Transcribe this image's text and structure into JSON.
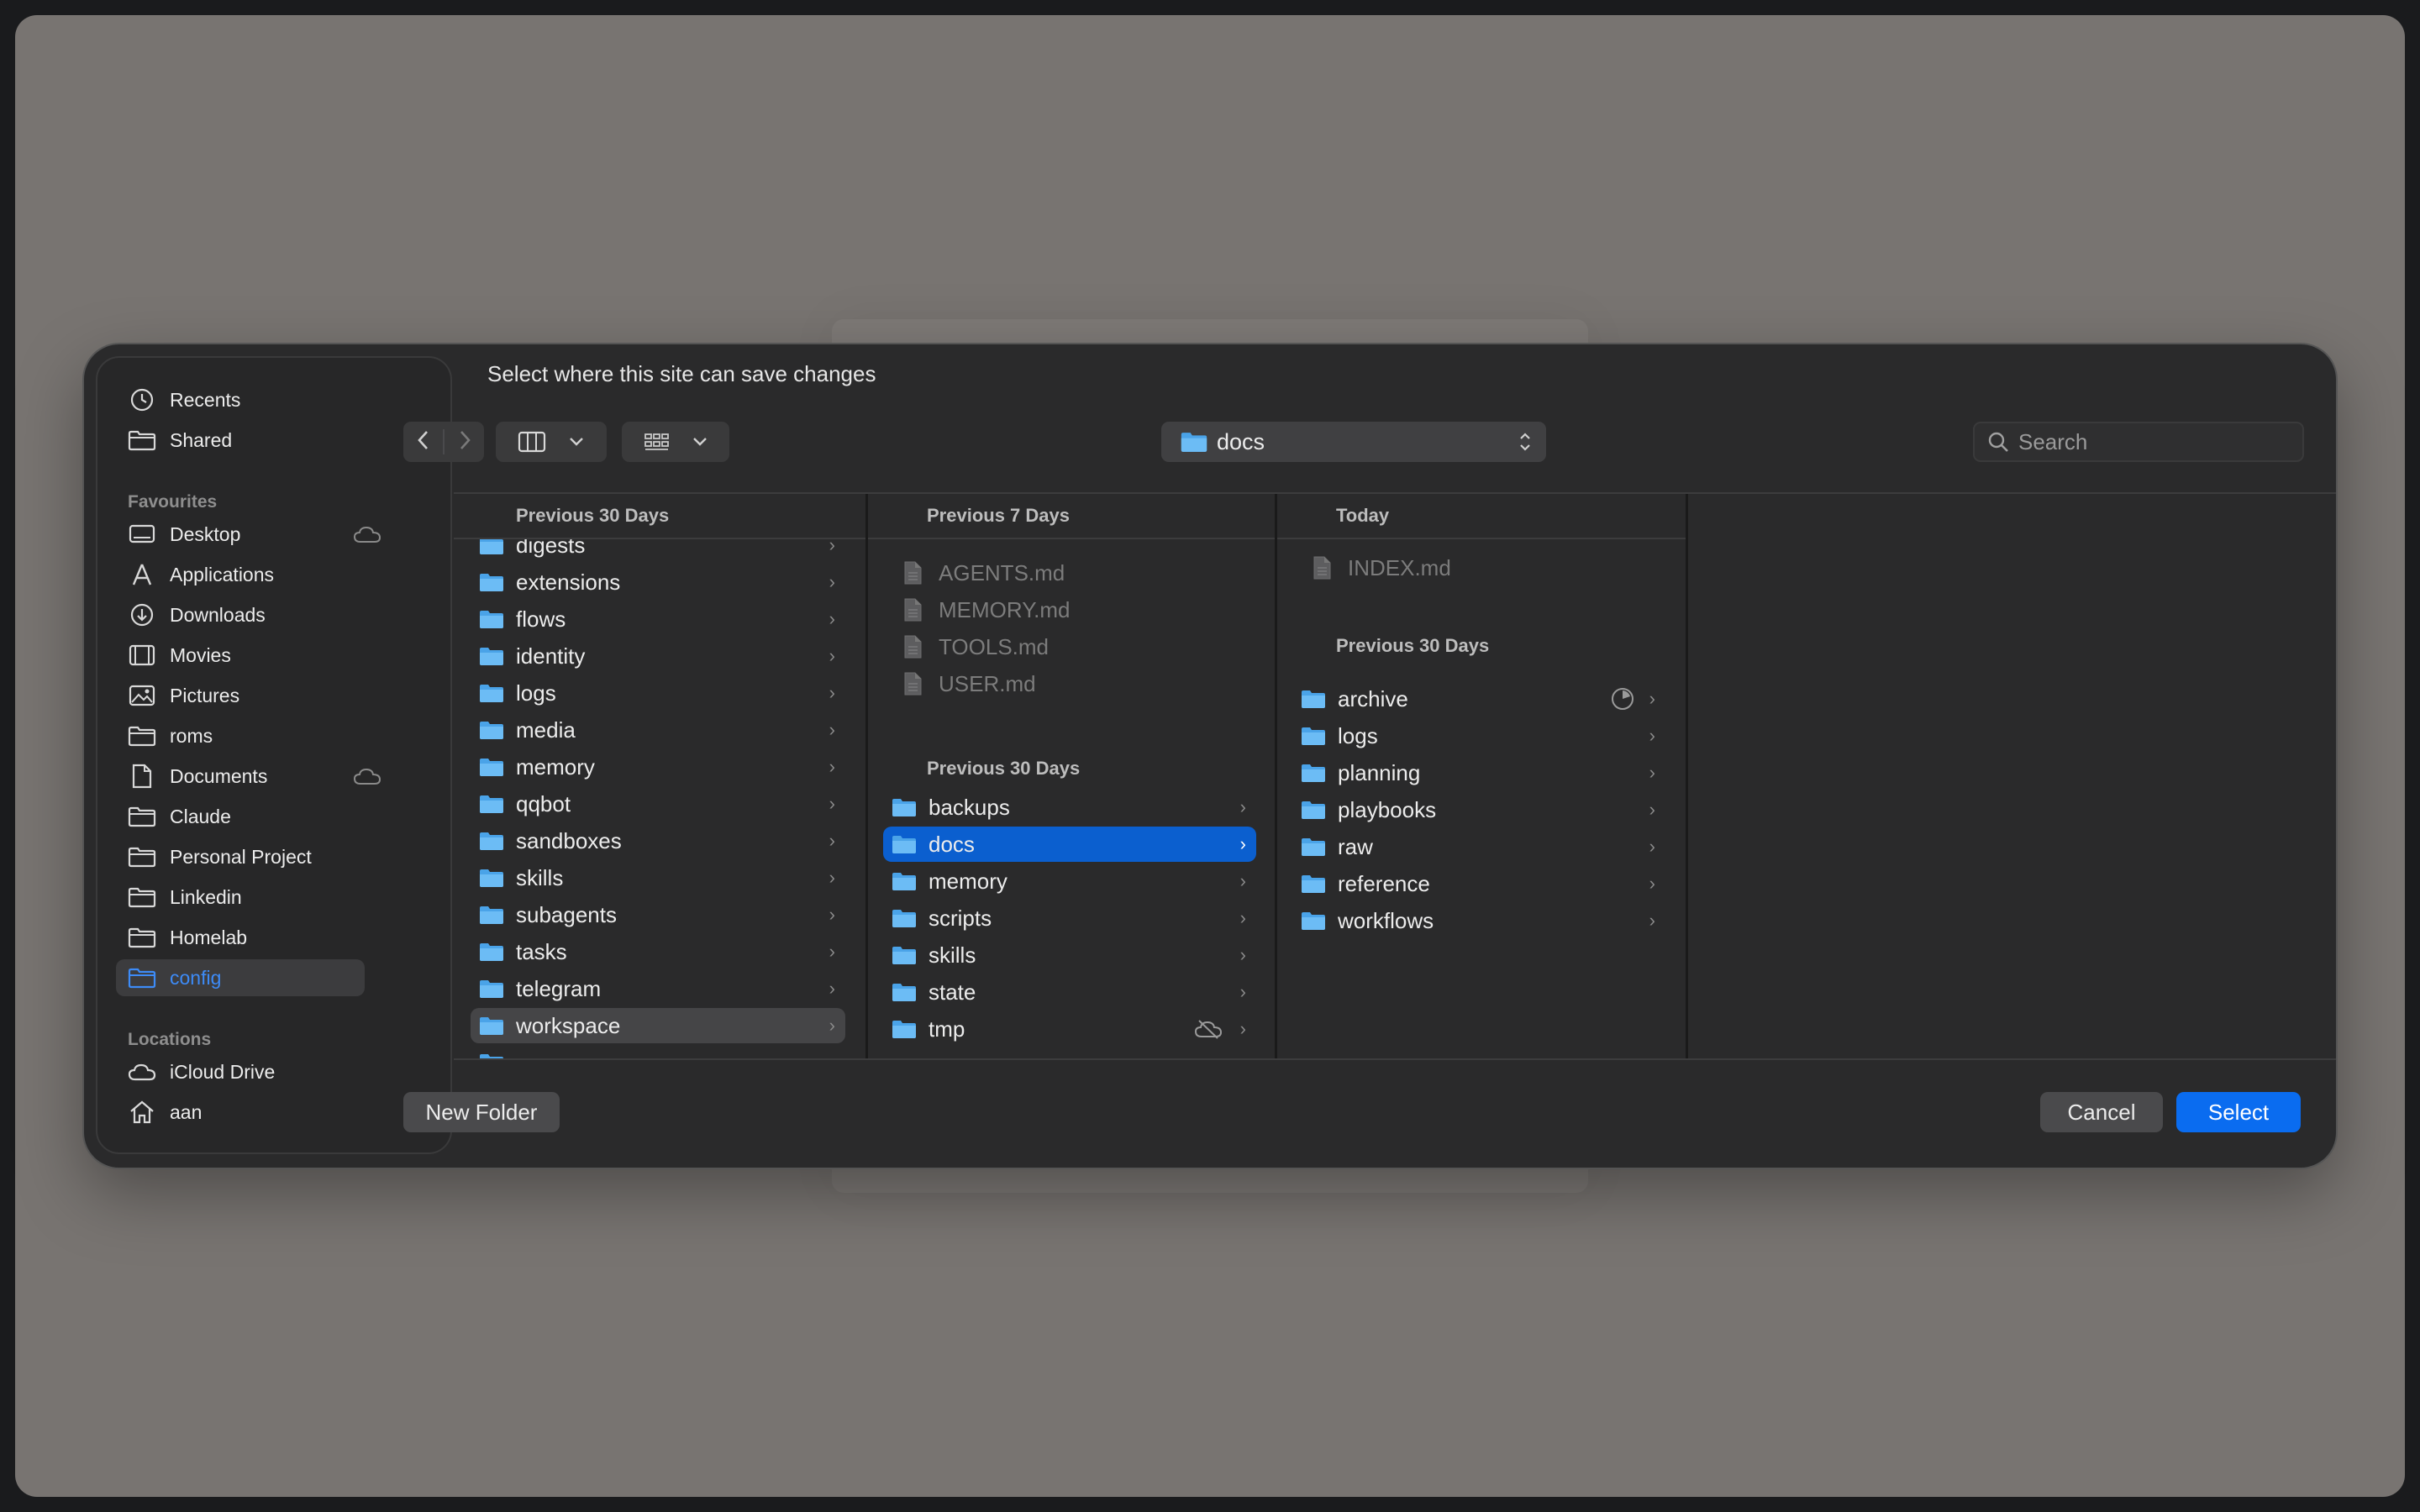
{
  "dialog": {
    "title": "Select where this site can save changes",
    "path_popup": "docs",
    "search_placeholder": "Search",
    "new_folder": "New Folder",
    "cancel": "Cancel",
    "select": "Select"
  },
  "sidebar": {
    "top_items": [
      {
        "label": "Recents",
        "icon": "clock-icon"
      },
      {
        "label": "Shared",
        "icon": "shared-folder-icon"
      }
    ],
    "favourites_header": "Favourites",
    "favourites": [
      {
        "label": "Desktop",
        "icon": "desktop-icon",
        "cloud": true
      },
      {
        "label": "Applications",
        "icon": "applications-icon"
      },
      {
        "label": "Downloads",
        "icon": "download-icon"
      },
      {
        "label": "Movies",
        "icon": "film-icon"
      },
      {
        "label": "Pictures",
        "icon": "photo-icon"
      },
      {
        "label": "roms",
        "icon": "folder-icon"
      },
      {
        "label": "Documents",
        "icon": "document-icon",
        "cloud": true
      },
      {
        "label": "Claude",
        "icon": "folder-icon"
      },
      {
        "label": "Personal Project",
        "icon": "folder-icon"
      },
      {
        "label": "Linkedin",
        "icon": "folder-icon"
      },
      {
        "label": "Homelab",
        "icon": "folder-icon"
      },
      {
        "label": "config",
        "icon": "folder-icon",
        "selected": true
      }
    ],
    "locations_header": "Locations",
    "locations": [
      {
        "label": "iCloud Drive",
        "icon": "cloud-icon"
      },
      {
        "label": "aan",
        "icon": "home-icon"
      }
    ]
  },
  "columns": {
    "col1": {
      "header": "Previous 30 Days",
      "items": [
        "digests",
        "extensions",
        "flows",
        "identity",
        "logs",
        "media",
        "memory",
        "qqbot",
        "sandboxes",
        "skills",
        "subagents",
        "tasks",
        "telegram",
        "workspace"
      ],
      "selected": "workspace"
    },
    "col2": {
      "section1_header": "Previous 7 Days",
      "files": [
        "AGENTS.md",
        "MEMORY.md",
        "TOOLS.md",
        "USER.md"
      ],
      "section2_header": "Previous 30 Days",
      "folders": [
        "backups",
        "docs",
        "memory",
        "scripts",
        "skills",
        "state",
        "tmp"
      ],
      "selected": "docs"
    },
    "col3": {
      "section1_header": "Today",
      "files": [
        "INDEX.md"
      ],
      "section2_header": "Previous 30 Days",
      "folders": [
        "archive",
        "logs",
        "planning",
        "playbooks",
        "raw",
        "reference",
        "workflows"
      ]
    }
  },
  "colors": {
    "accent": "#0a6cf0",
    "selection": "#0b5fcf",
    "folder": "#5fb2f0",
    "sidebar_selected_text": "#3d8bf7"
  }
}
